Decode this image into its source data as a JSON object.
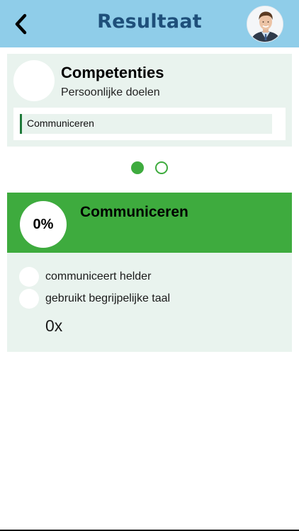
{
  "header": {
    "title": "Resultaat",
    "back_icon": "chevron-left-icon",
    "background_color": "#8fcde9",
    "title_color": "#1e4f7a"
  },
  "competence_card": {
    "title": "Competenties",
    "subtitle": "Persoonlijke doelen",
    "selected_item": "Communiceren",
    "background_color": "#e9f3ee"
  },
  "pager": {
    "total_pages": 2,
    "active_index": 0,
    "accent_color": "#3eab3e"
  },
  "result": {
    "percent": "0%",
    "title": "Communiceren",
    "header_color": "#3eab3e",
    "criteria": [
      {
        "label": "communiceert helder",
        "checked": false
      },
      {
        "label": "gebruikt begrijpelijke taal",
        "checked": false
      }
    ],
    "count": "0x"
  }
}
